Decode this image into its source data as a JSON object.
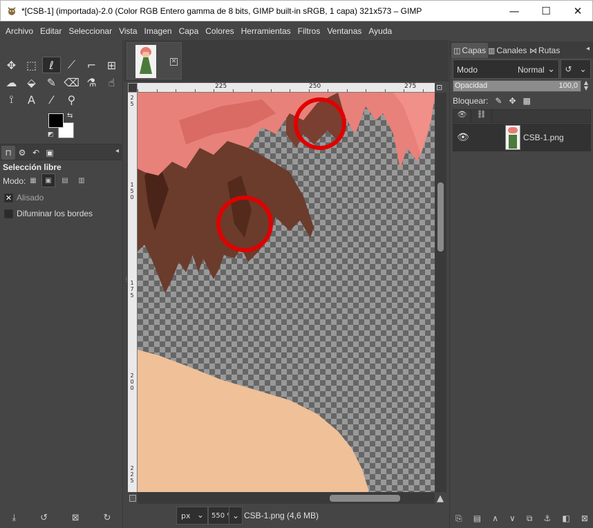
{
  "window": {
    "title": "*[CSB-1] (importada)-2.0 (Color RGB Entero gamma de 8 bits, GIMP built-in sRGB, 1 capa) 321x573 – GIMP",
    "min_glyph": "—",
    "max_glyph": "☐",
    "close_glyph": "✕"
  },
  "menu": [
    "Archivo",
    "Editar",
    "Seleccionar",
    "Vista",
    "Imagen",
    "Capa",
    "Colores",
    "Herramientas",
    "Filtros",
    "Ventanas",
    "Ayuda"
  ],
  "toolbox": {
    "tools": [
      {
        "name": "move-tool",
        "glyph": "✥"
      },
      {
        "name": "rect-select-tool",
        "glyph": "⬚"
      },
      {
        "name": "free-select-tool",
        "glyph": "ℓ",
        "active": true
      },
      {
        "name": "fuzzy-select-tool",
        "glyph": "⟋"
      },
      {
        "name": "crop-tool",
        "glyph": "⌐"
      },
      {
        "name": "unified-transform-tool",
        "glyph": "⊞"
      },
      {
        "name": "warp-tool",
        "glyph": "☁"
      },
      {
        "name": "bucket-fill-tool",
        "glyph": "⬙"
      },
      {
        "name": "paintbrush-tool",
        "glyph": "✎"
      },
      {
        "name": "eraser-tool",
        "glyph": "⌫"
      },
      {
        "name": "clone-tool",
        "glyph": "⚗"
      },
      {
        "name": "smudge-tool",
        "glyph": "☝"
      },
      {
        "name": "paths-tool",
        "glyph": "⟟"
      },
      {
        "name": "text-tool",
        "glyph": "A"
      },
      {
        "name": "color-picker-tool",
        "glyph": "⁄"
      },
      {
        "name": "zoom-tool",
        "glyph": "⚲"
      }
    ],
    "fg_color": "#000000",
    "bg_color": "#ffffff"
  },
  "tool_options": {
    "title": "Selección libre",
    "mode_label": "Modo:",
    "antialias_label": "Alisado",
    "feather_label": "Difuminar los bordes"
  },
  "canvas": {
    "ruler_labels": [
      "225",
      "250",
      "275"
    ],
    "vruler_labels": [
      [
        "2",
        "5"
      ],
      [
        "1",
        "5",
        "0"
      ],
      [
        "1",
        "7",
        "5"
      ],
      [
        "2",
        "0",
        "0"
      ],
      [
        "2",
        "2",
        "5"
      ]
    ],
    "unit": "px",
    "zoom": "550 %",
    "status": "CSB-1.png (4,6 MB)"
  },
  "layers_panel": {
    "tabs": [
      "Capas",
      "Canales",
      "Rutas"
    ],
    "mode_label": "Modo",
    "mode_value": "Normal",
    "opacity_label": "Opacidad",
    "opacity_value": "100,0",
    "opacity_fraction": 1.0,
    "lock_label": "Bloquear:",
    "layers": [
      {
        "name": "CSB-1.png",
        "visible": true
      }
    ]
  }
}
